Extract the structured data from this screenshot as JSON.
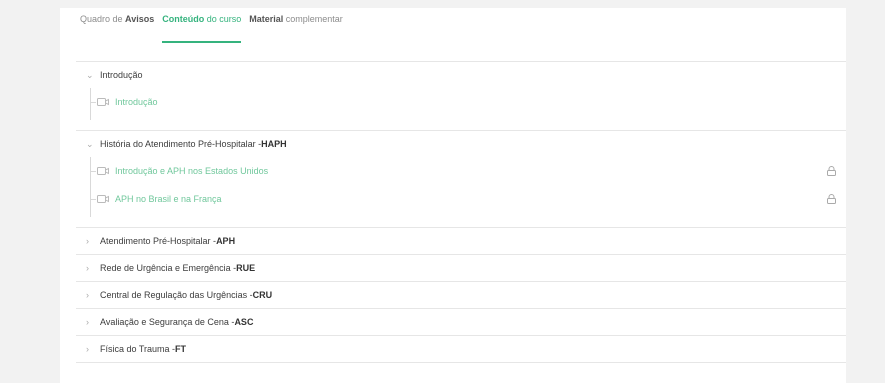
{
  "tabs": [
    {
      "prefix": "Quadro de ",
      "bold": "Avisos",
      "suffix": "",
      "active": false
    },
    {
      "prefix": "",
      "bold": "Conteúdo",
      "suffix": " do curso",
      "active": true
    },
    {
      "prefix": "",
      "bold": "Material",
      "suffix": " complementar",
      "active": false
    }
  ],
  "modules": [
    {
      "title": "Introdução",
      "title_bold": "",
      "expanded": true,
      "lessons": [
        {
          "label": "Introdução",
          "locked": false
        }
      ]
    },
    {
      "title": "História do Atendimento Pré-Hospitalar - ",
      "title_bold": "HAPH",
      "expanded": true,
      "lessons": [
        {
          "label": "Introdução e APH nos Estados Unidos",
          "locked": true
        },
        {
          "label": "APH no Brasil e na França",
          "locked": true
        }
      ]
    },
    {
      "title": "Atendimento Pré-Hospitalar - ",
      "title_bold": "APH",
      "expanded": false,
      "lessons": []
    },
    {
      "title": "Rede de Urgência e Emergência - ",
      "title_bold": "RUE",
      "expanded": false,
      "lessons": []
    },
    {
      "title": "Central de Regulação das Urgências - ",
      "title_bold": "CRU",
      "expanded": false,
      "lessons": []
    },
    {
      "title": "Avaliação e Segurança de Cena - ",
      "title_bold": "ASC",
      "expanded": false,
      "lessons": []
    },
    {
      "title": "Física do Trauma - ",
      "title_bold": "FT",
      "expanded": false,
      "lessons": []
    }
  ],
  "icons": {
    "expanded": "chevron-down-icon",
    "collapsed": "chevron-right-icon",
    "lesson": "video-icon",
    "lock": "lock-icon"
  },
  "colors": {
    "accent": "#35b37e",
    "lesson_text": "#6fc79b",
    "background": "#f2f2f2"
  }
}
